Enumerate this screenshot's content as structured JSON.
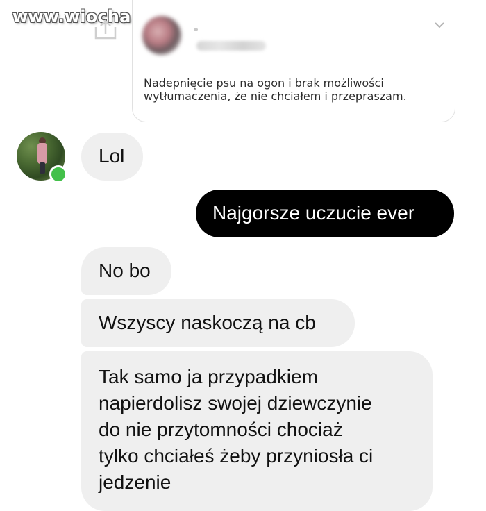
{
  "watermark": {
    "text": "www.wiocha.pl"
  },
  "shared_post": {
    "caption_line1": "Nadepnięcie psu na ogon i brak możliwości",
    "caption_line2": "wytłumaczenia, że nie chciałem i przepraszam."
  },
  "messages": [
    {
      "id": "m1",
      "sender": "contact",
      "text": "Lol"
    },
    {
      "id": "m2",
      "sender": "me",
      "text": "Najgorsze uczucie ever"
    },
    {
      "id": "m3",
      "sender": "contact",
      "text": "No bo"
    },
    {
      "id": "m4",
      "sender": "contact",
      "text": "Wszyscy naskoczą na cb"
    },
    {
      "id": "m5",
      "sender": "contact",
      "lines": [
        "Tak samo ja przypadkiem",
        "napierdolisz swojej dziewczynie",
        "do nie przytomności chociaż",
        "tylko chciałeś żeby przyniosła ci",
        "jedzenie"
      ]
    }
  ],
  "colors": {
    "incoming_bubble": "#efefef",
    "outgoing_bubble": "#000000",
    "online_indicator": "#43c04a",
    "background": "#ffffff"
  },
  "icons": {
    "share": "share-icon",
    "chevron": "chevron-down-icon"
  }
}
